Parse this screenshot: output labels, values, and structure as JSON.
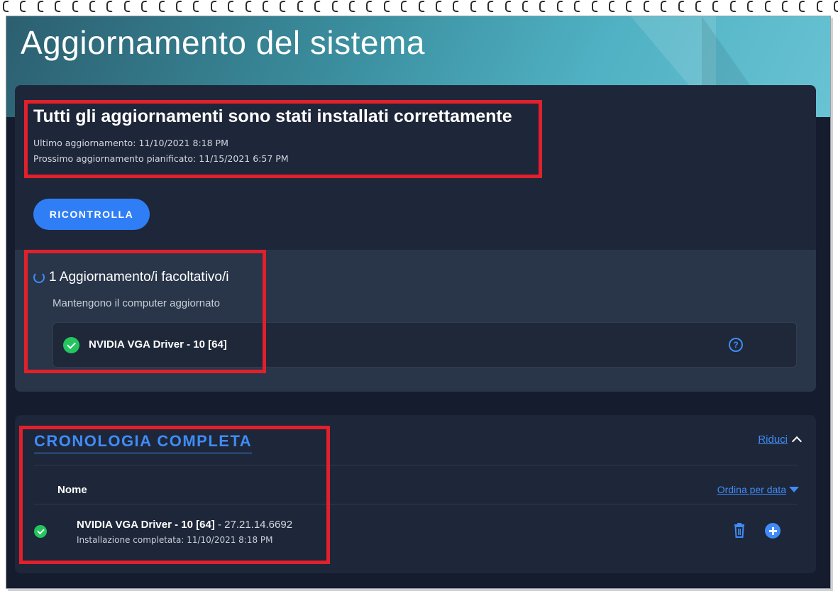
{
  "header": {
    "title": "Aggiornamento del sistema"
  },
  "status": {
    "title": "Tutti gli aggiornamenti sono stati installati correttamente",
    "last_update": "Ultimo aggiornamento: 11/10/2021 8:18 PM",
    "next_update": "Prossimo aggiornamento pianificato: 11/15/2021 6:57 PM",
    "recheck_label": "RICONTROLLA"
  },
  "optional": {
    "title": "1 Aggiornamento/i facoltativo/i",
    "subtitle": "Mantengono il computer aggiornato",
    "driver_name": "NVIDIA VGA Driver - 10 [64]"
  },
  "history": {
    "title": "CRONOLOGIA COMPLETA",
    "collapse_label": "Riduci",
    "column_name": "Nome",
    "sort_label": "Ordina per data",
    "items": [
      {
        "name": "NVIDIA VGA Driver - 10 [64]",
        "version": " - 27.21.14.6692",
        "status": "Installazione completata: 11/10/2021 8:18 PM"
      }
    ]
  },
  "colors": {
    "accent": "#3f8cf6",
    "success": "#22c55e",
    "highlight": "#e0202b",
    "card": "#1e2639"
  }
}
